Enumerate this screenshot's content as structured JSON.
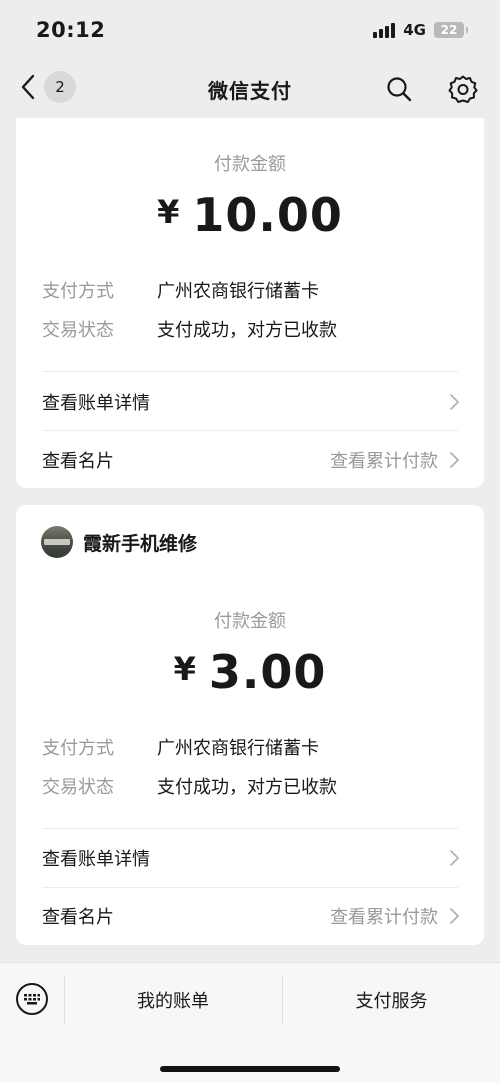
{
  "status_bar": {
    "time": "20:12",
    "network": "4G",
    "battery": "22"
  },
  "nav": {
    "back_badge": "2",
    "title": "微信支付"
  },
  "cards": [
    {
      "amount_label": "付款金额",
      "currency": "¥",
      "amount": "10.00",
      "payment_method_key": "支付方式",
      "payment_method_val": "广州农商银行储蓄卡",
      "status_key": "交易状态",
      "status_val": "支付成功，对方已收款",
      "bill_detail": "查看账单详情",
      "view_card": "查看名片",
      "view_total": "查看累计付款"
    },
    {
      "merchant_name": "霞新手机维修",
      "amount_label": "付款金额",
      "currency": "¥",
      "amount": "3.00",
      "payment_method_key": "支付方式",
      "payment_method_val": "广州农商银行储蓄卡",
      "status_key": "交易状态",
      "status_val": "支付成功，对方已收款",
      "bill_detail": "查看账单详情",
      "view_card": "查看名片",
      "view_total": "查看累计付款"
    }
  ],
  "bottom_bar": {
    "my_bills": "我的账单",
    "pay_services": "支付服务"
  },
  "icons": {
    "back": "chevron-left-icon",
    "search": "search-icon",
    "settings": "gear-icon",
    "keyboard": "keyboard-icon",
    "chevron": "chevron-right-icon"
  }
}
